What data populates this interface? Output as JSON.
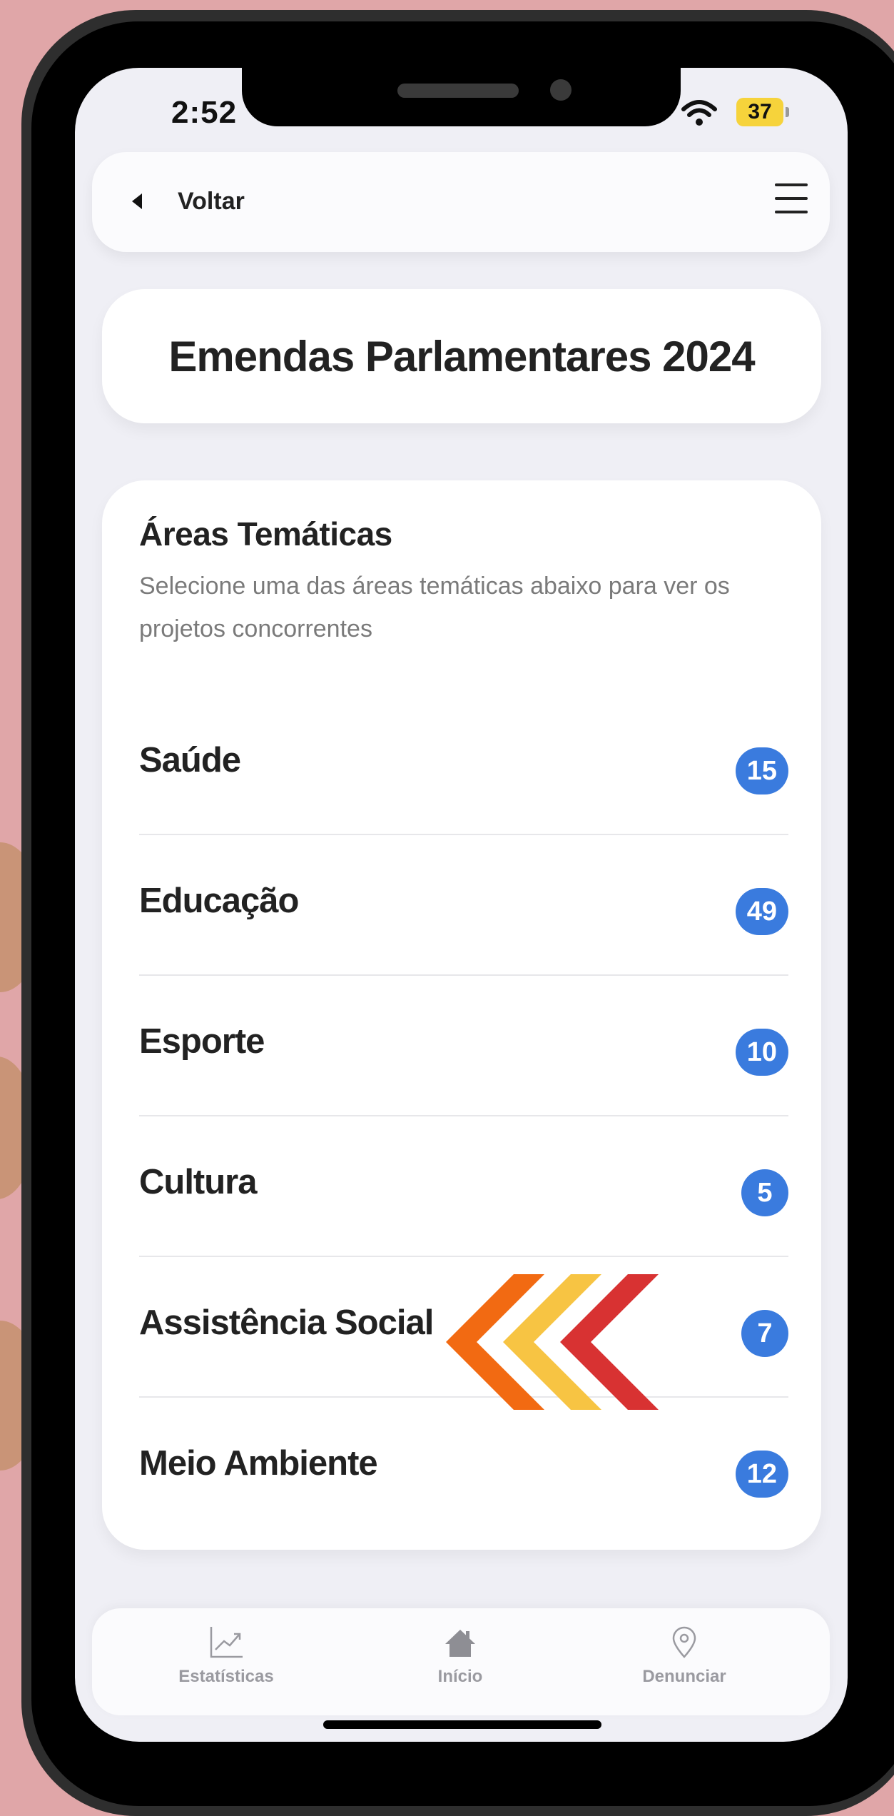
{
  "status_bar": {
    "time": "2:52",
    "battery": "37",
    "battery_color": "#f6d33b"
  },
  "topbar": {
    "back_label": "Voltar",
    "back_icon": "back-arrow-icon",
    "menu_icon": "hamburger-menu-icon"
  },
  "page_title": "Emendas Parlamentares 2024",
  "areas": {
    "title": "Áreas Temáticas",
    "subtitle": "Selecione uma das áreas temáticas abaixo para ver os projetos concorrentes",
    "items": [
      {
        "label": "Saúde",
        "count": "15"
      },
      {
        "label": "Educação",
        "count": "49"
      },
      {
        "label": "Esporte",
        "count": "10"
      },
      {
        "label": "Cultura",
        "count": "5"
      },
      {
        "label": "Assistência Social",
        "count": "7"
      },
      {
        "label": "Meio Ambiente",
        "count": "12"
      }
    ],
    "badge_color": "#3a7bde"
  },
  "overlay": {
    "icon": "triple-chevron-left-icon",
    "colors": [
      "#f26a12",
      "#f7c443",
      "#d83232"
    ]
  },
  "bottom_nav": {
    "items": [
      {
        "label": "Estatísticas",
        "icon": "chart-icon"
      },
      {
        "label": "Início",
        "icon": "home-icon"
      },
      {
        "label": "Denunciar",
        "icon": "location-pin-icon"
      }
    ]
  }
}
